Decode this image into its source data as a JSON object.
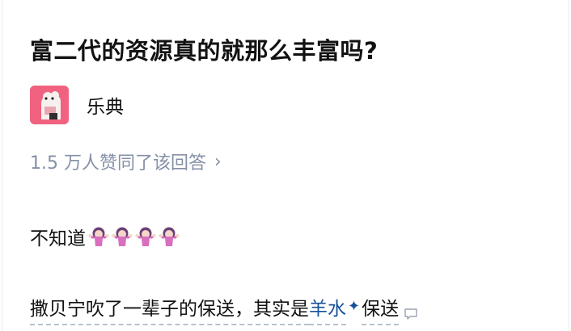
{
  "question": {
    "title": "富二代的资源真的就那么丰富吗?"
  },
  "author": {
    "name": "乐典",
    "avatar_icon": "avatar-image"
  },
  "votes": {
    "text": "1.5 万人赞同了该回答",
    "chevron": "›"
  },
  "answer": {
    "para1_text": "不知道",
    "para1_emojis": [
      "person-shrugging-emoji",
      "person-shrugging-emoji",
      "person-shrugging-emoji",
      "person-shrugging-emoji"
    ],
    "para2_before": "撒贝宁吹了一辈子的保送，其实是",
    "para2_link": "羊水",
    "para2_sparkle": "✦",
    "para2_after": "保送"
  },
  "colors": {
    "link": "#175199",
    "meta": "#8590a6",
    "avatar_bg": "#f0627f"
  }
}
